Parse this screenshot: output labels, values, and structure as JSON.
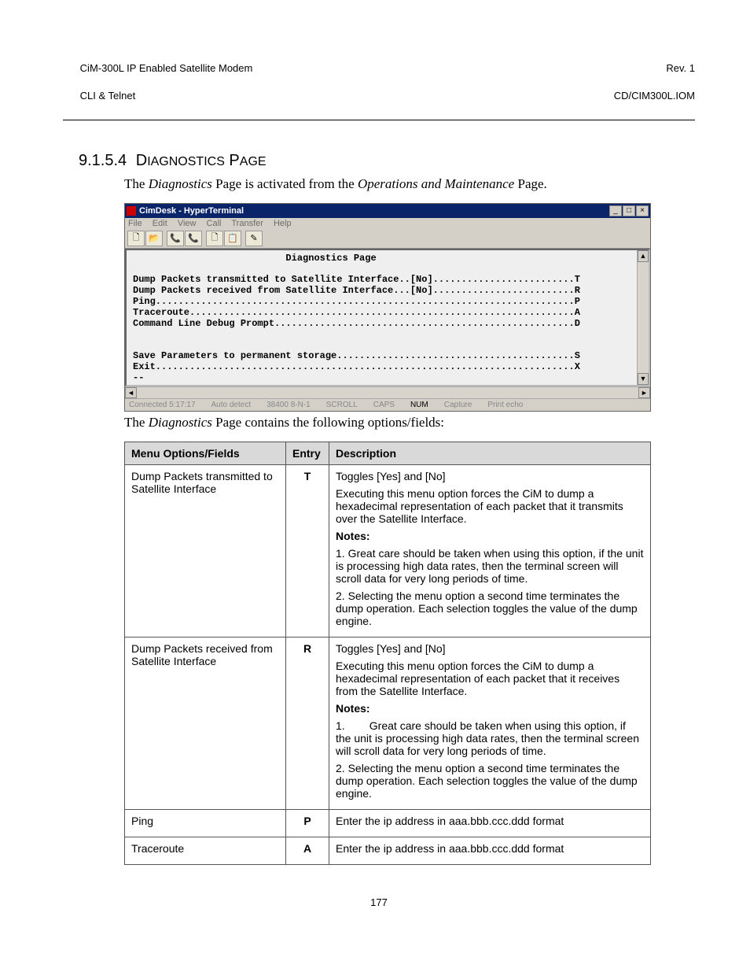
{
  "header": {
    "left_line1": "CiM-300L IP Enabled Satellite Modem",
    "left_line2": "CLI & Telnet",
    "right_line1": "Rev. 1",
    "right_line2": "CD/CIM300L.IOM"
  },
  "section": {
    "number": "9.1.5.4",
    "title": "Diagnostics Page",
    "intro_prefix": "The ",
    "intro_em1": "Diagnostics",
    "intro_mid": " Page is activated from the ",
    "intro_em2": "Operations and Maintenance",
    "intro_suffix": " Page.",
    "after_prefix": "The ",
    "after_em": "Diagnostics",
    "after_suffix": " Page contains the following options/fields:"
  },
  "hyperterm": {
    "title": "CimDesk - HyperTerminal",
    "menus": [
      "File",
      "Edit",
      "View",
      "Call",
      "Transfer",
      "Help"
    ],
    "toolbar_glyphs": [
      "🗋",
      "📂",
      "📞",
      "📞",
      "🗋",
      "📋",
      "✎"
    ],
    "terminal_text": "                           Diagnostics Page\n\nDump Packets transmitted to Satellite Interface..[No].........................T\nDump Packets received from Satellite Interface...[No].........................R\nPing..........................................................................P\nTraceroute....................................................................A\nCommand Line Debug Prompt.....................................................D\n\n\nSave Parameters to permanent storage..........................................S\nExit..........................................................................X\n--",
    "status": [
      "Connected 5:17:17",
      "Auto detect",
      "38400 8-N-1",
      "SCROLL",
      "CAPS",
      "NUM",
      "Capture",
      "Print echo"
    ]
  },
  "table": {
    "headers": {
      "menu": "Menu Options/Fields",
      "entry": "Entry",
      "desc": "Description"
    },
    "rows": [
      {
        "menu": "Dump Packets transmitted to Satellite Interface",
        "entry": "T",
        "desc": {
          "p1": "Toggles [Yes] and [No]",
          "p2": "Executing this menu option forces the CiM to dump a hexadecimal representation of each packet that it transmits over the Satellite Interface.",
          "notes": "Notes:",
          "n1": "1. Great care should be taken when using this option, if the unit is processing high data rates, then the terminal screen will scroll data for very long periods of time.",
          "n2": "2. Selecting the menu option a second time terminates the dump operation. Each selection toggles the value of the dump engine."
        }
      },
      {
        "menu": "Dump Packets received from Satellite Interface",
        "entry": "R",
        "desc": {
          "p1": "Toggles [Yes] and [No]",
          "p2": "Executing this menu option forces the CiM to dump a hexadecimal representation of each packet that it receives from the Satellite Interface.",
          "notes": "Notes:",
          "n1": "1.        Great care should be taken when using this option, if the unit is processing high data rates, then the terminal screen will scroll data for very long periods of time.",
          "n2": "2. Selecting the menu option a second time terminates the dump operation. Each selection toggles the value of the dump engine."
        }
      },
      {
        "menu": "Ping",
        "entry": "P",
        "desc": {
          "p1": "Enter the ip address in aaa.bbb.ccc.ddd format"
        }
      },
      {
        "menu": "Traceroute",
        "entry": "A",
        "desc": {
          "p1": "Enter the ip address in aaa.bbb.ccc.ddd format"
        }
      }
    ]
  },
  "page_number": "177"
}
